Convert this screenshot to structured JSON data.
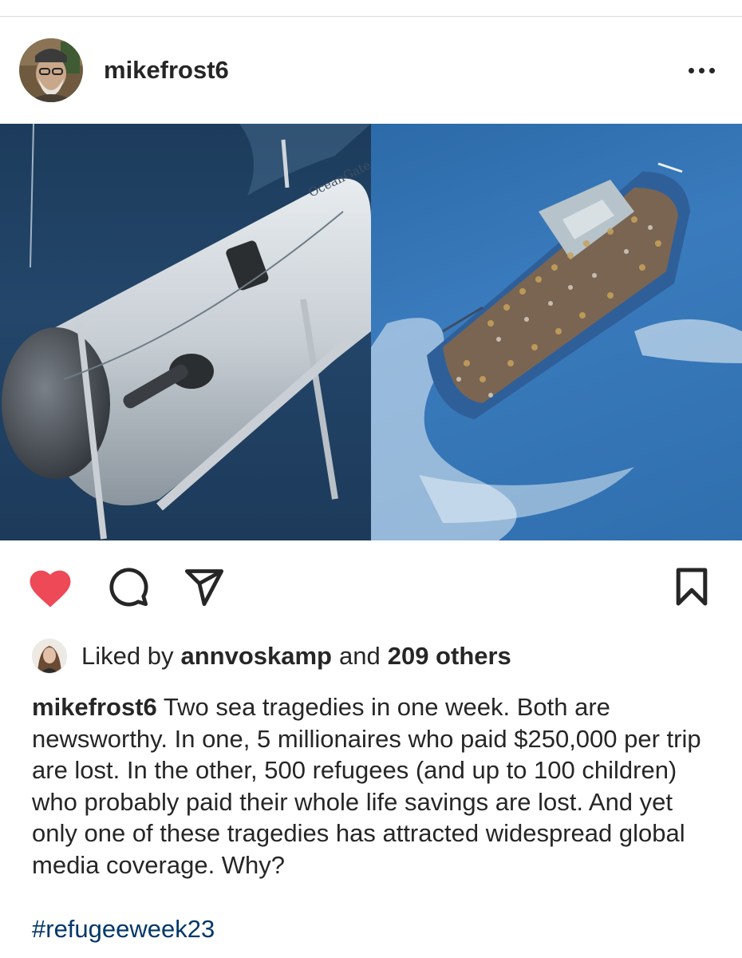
{
  "post": {
    "username": "mikefrost6",
    "liked_by_prefix": "Liked by",
    "liked_by_user": "annvoskamp",
    "liked_by_and": "and",
    "liked_by_others": "209 others",
    "caption_user": "mikefrost6",
    "caption_text": "Two sea tragedies in one week. Both are newsworthy. In one, 5 millionaires who paid $250,000 per trip are lost. In the other, 500 refugees (and up to 100 children) who probably paid their whole life savings are lost. And yet only one of these tragedies has attracted widespread global media coverage. Why?",
    "hashtag": "#refugeeweek23",
    "submersible_label": "OceanGate"
  },
  "icons": {
    "more": "more-options-icon",
    "like": "heart-icon",
    "comment": "comment-icon",
    "share": "share-icon",
    "save": "bookmark-icon"
  },
  "colors": {
    "like_red": "#ed4956",
    "hashtag_blue": "#00376b",
    "text": "#262626"
  }
}
